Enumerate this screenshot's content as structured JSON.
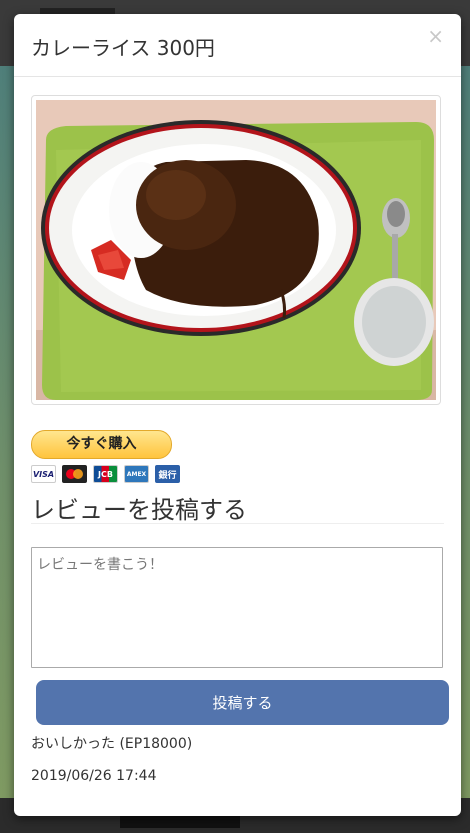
{
  "modal": {
    "title": "カレーライス 300円",
    "close_label": "×"
  },
  "photo": {
    "subject": "curry rice on green tray"
  },
  "purchase": {
    "button_label": "今すぐ購入",
    "cards": [
      "VISA",
      "MasterCard",
      "JCB",
      "AMEX",
      "銀行"
    ]
  },
  "review_form": {
    "heading": "レビューを投稿する",
    "placeholder": "レビューを書こう！",
    "submit_label": "投稿する"
  },
  "reviews": [
    {
      "text": "おいしかった (EP18000)",
      "date": "2019/06/26 17:44"
    }
  ],
  "colors": {
    "submit": "#5374ad",
    "buy_button": "#ffc43d",
    "tray": "#9cc24a"
  }
}
